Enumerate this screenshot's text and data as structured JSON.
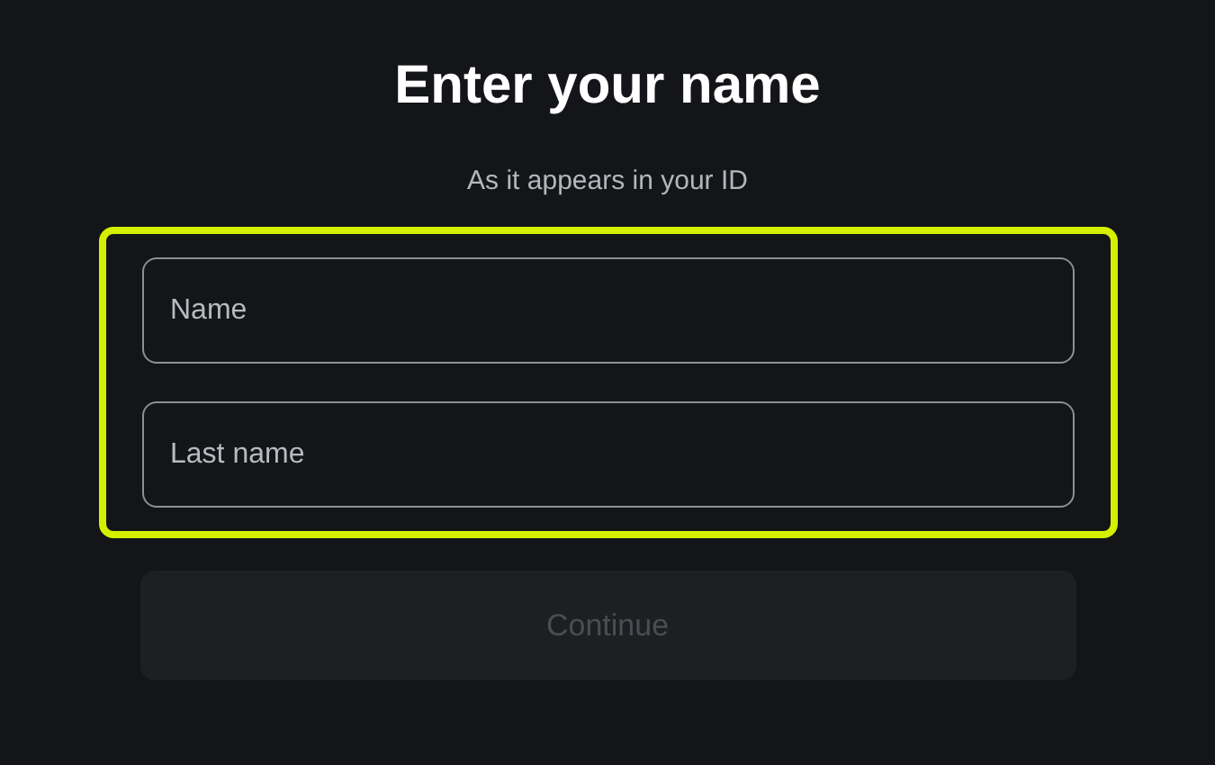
{
  "title": "Enter your name",
  "subtitle": "As it appears in your ID",
  "highlight": true,
  "fields": [
    {
      "placeholder": "Name"
    },
    {
      "placeholder": "Last name"
    }
  ],
  "continue_button": {
    "label": "Continue",
    "disabled": true
  }
}
